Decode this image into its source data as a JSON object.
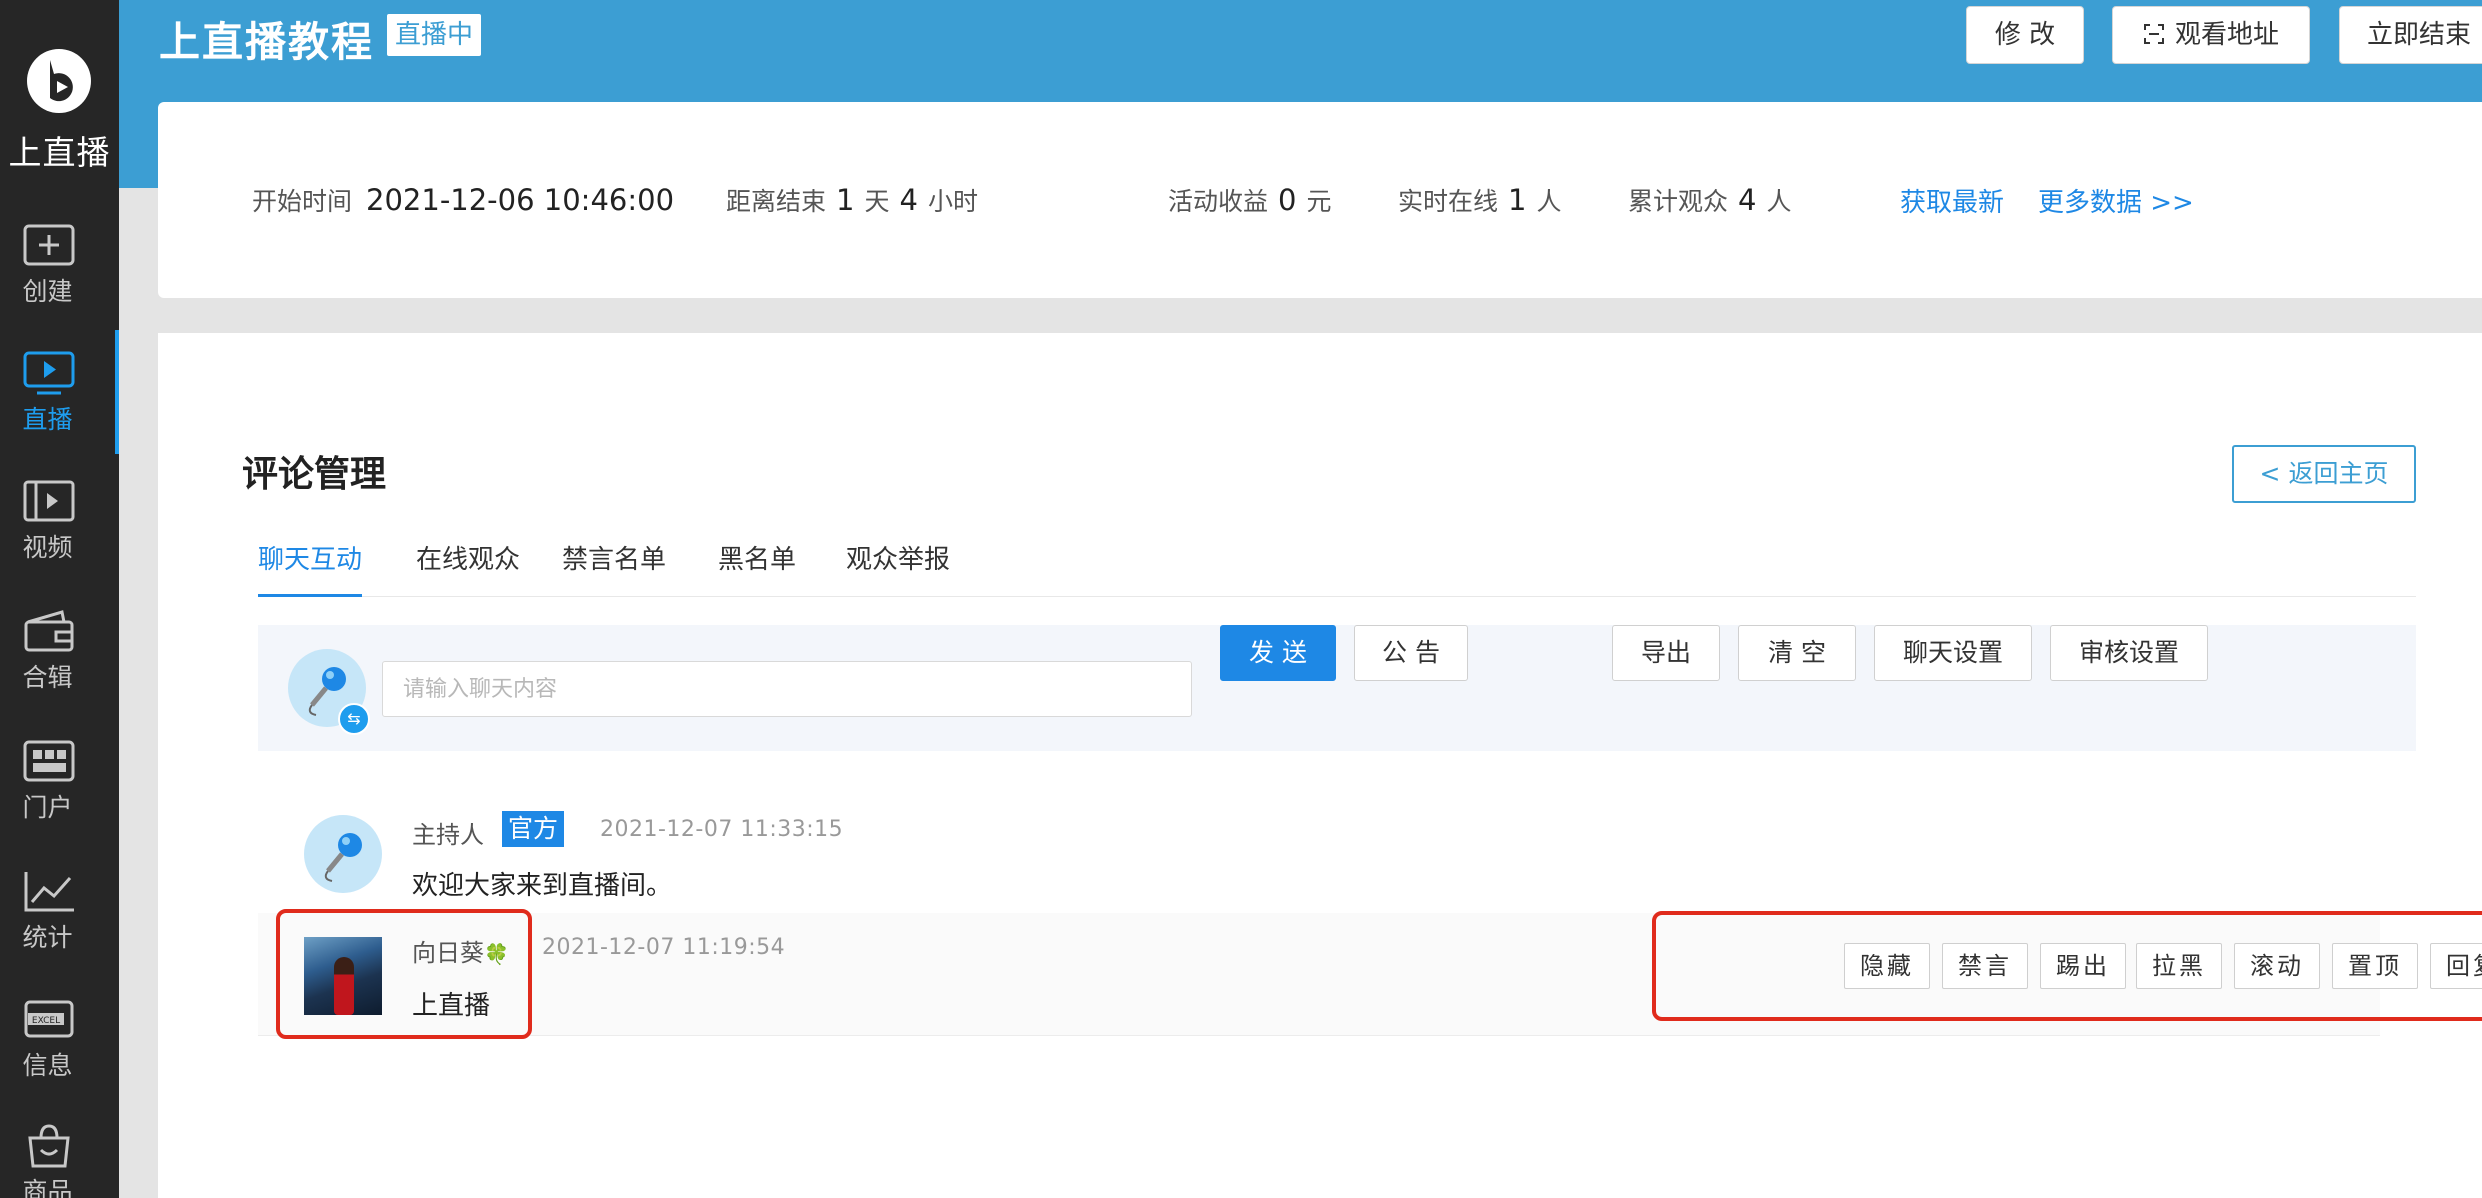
{
  "sidebar": {
    "logo_text": "上直播",
    "items": [
      {
        "label": "创建",
        "icon": "plus-box-icon"
      },
      {
        "label": "直播",
        "icon": "play-screen-icon",
        "active": true
      },
      {
        "label": "视频",
        "icon": "film-icon"
      },
      {
        "label": "合辑",
        "icon": "wallet-icon"
      },
      {
        "label": "门户",
        "icon": "grid-icon"
      },
      {
        "label": "统计",
        "icon": "line-chart-icon"
      },
      {
        "label": "信息",
        "icon": "excel-icon"
      },
      {
        "label": "商品",
        "icon": "shopping-bag-icon"
      }
    ]
  },
  "header": {
    "title": "上直播教程",
    "status_badge": "直播中",
    "buttons": {
      "edit": "修 改",
      "watch_url": "观看地址",
      "end_now": "立即结束"
    }
  },
  "stats": {
    "start_label": "开始时间",
    "start_value": "2021-12-06 10:46:00",
    "remain_label": "距离结束",
    "remain_days": "1",
    "days_unit": "天",
    "remain_hours": "4",
    "hours_unit": "小时",
    "income_label": "活动收益",
    "income_value": "0",
    "income_unit": "元",
    "online_label": "实时在线",
    "online_value": "1",
    "online_unit": "人",
    "total_label": "累计观众",
    "total_value": "4",
    "total_unit": "人",
    "refresh_link": "获取最新",
    "more_link": "更多数据 >>"
  },
  "main": {
    "title": "评论管理",
    "back_button": "< 返回主页",
    "tabs": [
      "聊天互动",
      "在线观众",
      "禁言名单",
      "黑名单",
      "观众举报"
    ],
    "input_placeholder": "请输入聊天内容",
    "send_button": "发 送",
    "notice_button": "公 告",
    "export_button": "导出",
    "clear_button": "清 空",
    "chat_settings_button": "聊天设置",
    "review_settings_button": "审核设置"
  },
  "messages": [
    {
      "name": "主持人",
      "badge": "官方",
      "time": "2021-12-07 11:33:15",
      "text": "欢迎大家来到直播间。"
    },
    {
      "name": "向日葵",
      "emoji": "🍀",
      "time": "2021-12-07 11:19:54",
      "text": "上直播",
      "actions": [
        "隐藏",
        "禁言",
        "踢出",
        "拉黑",
        "滚动",
        "置顶",
        "回复"
      ]
    }
  ],
  "colors": {
    "accent": "#1e88e5",
    "header_bg": "#3c9ed3",
    "sidebar_bg": "#262626",
    "highlight_box": "#e02b1c"
  }
}
